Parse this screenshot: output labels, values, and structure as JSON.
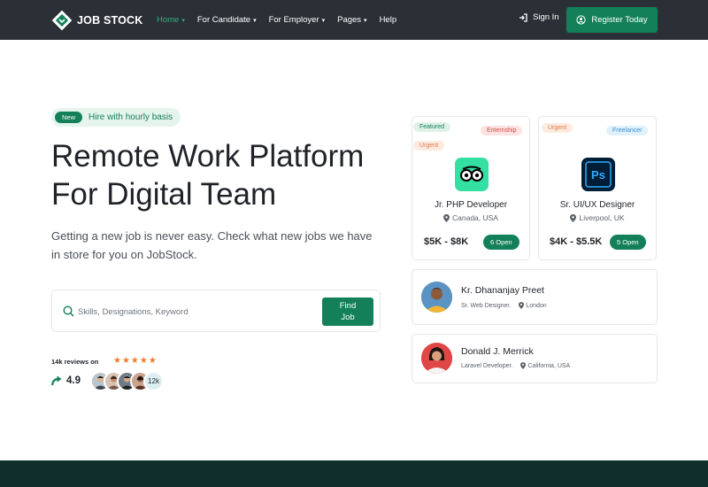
{
  "brand": {
    "name": "JOB STOCK",
    "accent": "#13805a",
    "nav_bg": "#2b3036"
  },
  "nav": {
    "links": [
      {
        "label": "Home",
        "has_dropdown": true,
        "active": true
      },
      {
        "label": "For Candidate",
        "has_dropdown": true
      },
      {
        "label": "For Employer",
        "has_dropdown": true
      },
      {
        "label": "Pages",
        "has_dropdown": true
      },
      {
        "label": "Help",
        "has_dropdown": false
      }
    ],
    "sign_in": "Sign In",
    "register": "Register Today"
  },
  "hero": {
    "badge_pill": "New",
    "badge_text": "Hire with hourly basis",
    "title_line1": "Remote Work Platform",
    "title_line2": "For Digital Team",
    "description": "Getting a new job is never easy. Check what new jobs we have in store for you on JobStock.",
    "search_placeholder": "Skills, Designations, Keyword",
    "find_label_1": "Find",
    "find_label_2": "Job",
    "reviews_label": "14k reviews on",
    "stars": "★★★★★",
    "rating": "4.9",
    "avatar_count": "12k"
  },
  "jobs": [
    {
      "tags": [
        "Featured",
        "Urgent",
        "Enternship"
      ],
      "logo": "tripadvisor-logo",
      "title": "Jr. PHP Developer",
      "location": "Canada, USA",
      "salary": "$5K - $8K",
      "open": "6 Open"
    },
    {
      "tags": [
        "Urgent",
        "Freelancer"
      ],
      "logo": "photoshop-logo",
      "logo_text": "Ps",
      "title": "Sr. UI/UX Designer",
      "location": "Liverpool, UK",
      "salary": "$4K - $5.5K",
      "open": "5 Open"
    }
  ],
  "candidates": [
    {
      "name": "Kr. Dhananjay Preet",
      "role": "Sr. Web Designer.",
      "location": "London"
    },
    {
      "name": "Donald J. Merrick",
      "role": "Laravel Developer.",
      "location": "California, USA"
    }
  ]
}
